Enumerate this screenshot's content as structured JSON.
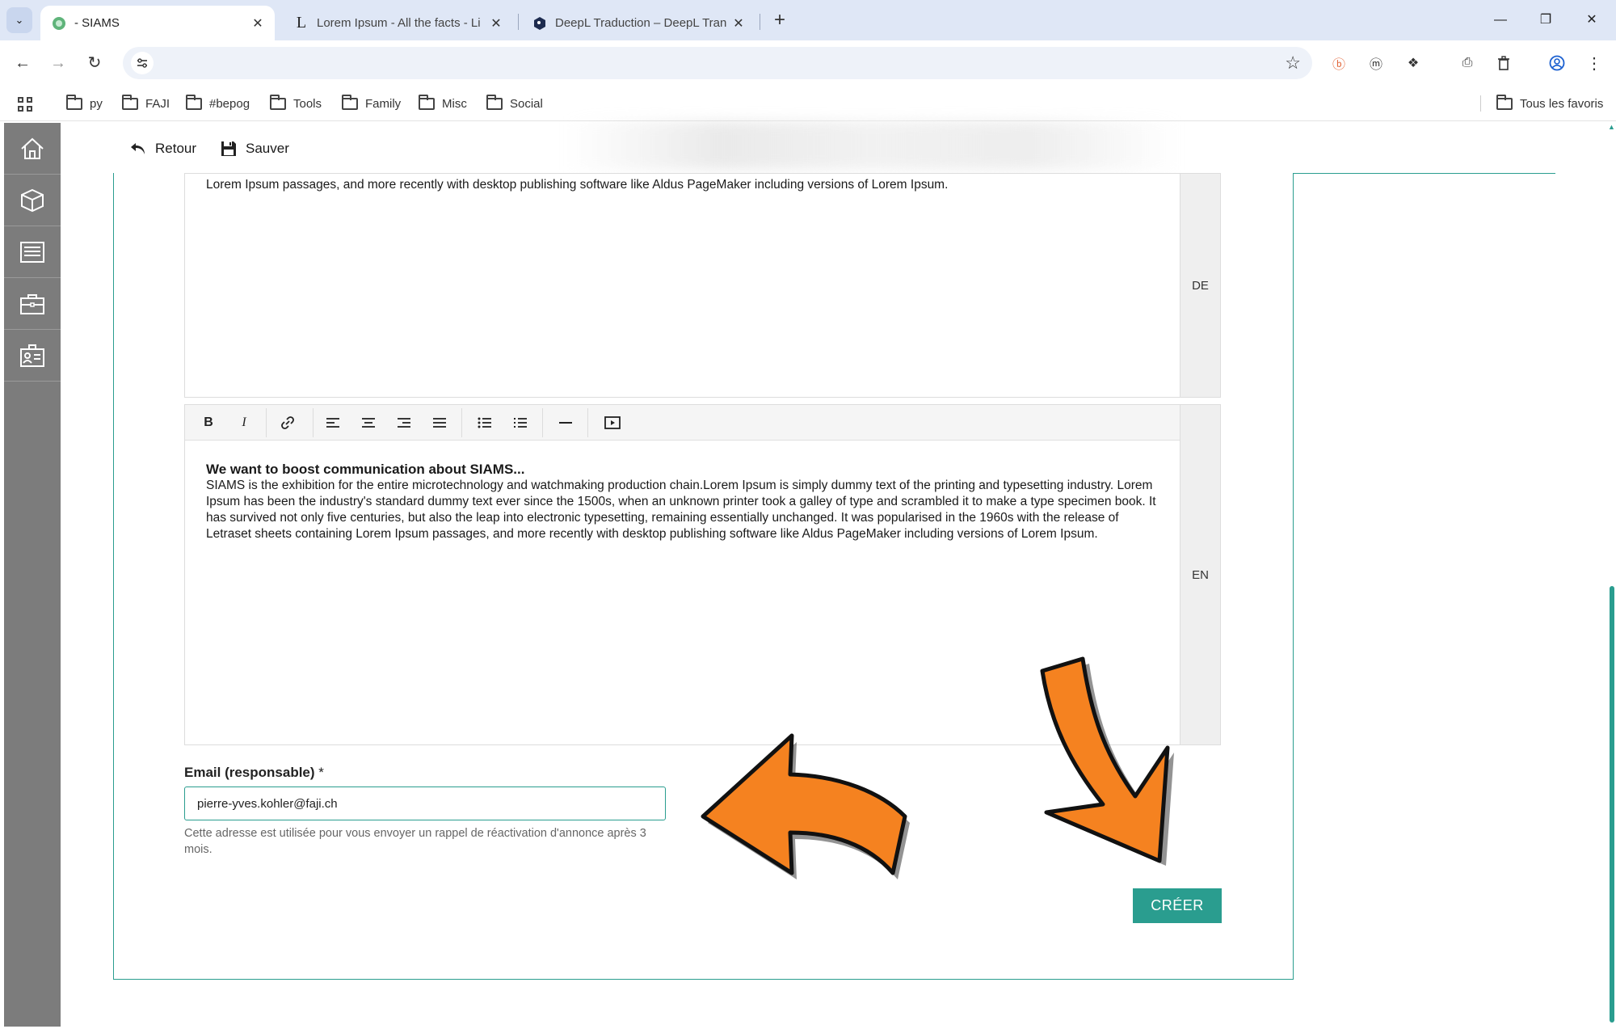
{
  "browser": {
    "tabs": [
      {
        "title": "- SIAMS",
        "active": true
      },
      {
        "title": "Lorem Ipsum - All the facts - Li",
        "active": false
      },
      {
        "title": "DeepL Traduction – DeepL Tran",
        "active": false
      }
    ],
    "bookmarks": [
      "py",
      "FAJI",
      "#bepog",
      "Tools",
      "Family",
      "Misc",
      "Social"
    ],
    "all_bookmarks": "Tous les favoris"
  },
  "app": {
    "toolbar": {
      "back_label": "Retour",
      "save_label": "Sauver"
    },
    "editor_de": {
      "lang": "DE",
      "text": "Lorem Ipsum passages, and more recently with desktop publishing software like Aldus PageMaker including versions of Lorem Ipsum."
    },
    "editor_en": {
      "lang": "EN",
      "heading": "We want to boost communication about SIAMS...",
      "body": "SIAMS is the exhibition for the entire microtechnology and watchmaking production chain.Lorem Ipsum is simply dummy text of the printing and typesetting industry. Lorem Ipsum has been the industry's standard dummy text ever since the 1500s, when an unknown printer took a galley of type and scrambled it to make a type specimen book. It has survived not only five centuries, but also the leap into electronic typesetting, remaining essentially unchanged. It was popularised in the 1960s with the release of Letraset sheets containing Lorem Ipsum passages, and more recently with desktop publishing software like Aldus PageMaker including versions of Lorem Ipsum."
    },
    "email": {
      "label": "Email (responsable)",
      "required_mark": "*",
      "value": "pierre-yves.kohler@faji.ch",
      "help": "Cette adresse est utilisée pour vous envoyer un rappel de réactivation d'annonce après 3 mois."
    },
    "create_label": "CRÉER"
  },
  "colors": {
    "accent": "#2a9d8f",
    "arrow": "#f58220",
    "sidebar": "#7c7c7c"
  }
}
